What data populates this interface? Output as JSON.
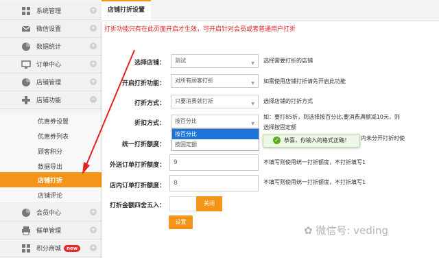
{
  "sidebar": {
    "items": [
      {
        "label": "系统管理",
        "icon": "grid-icon"
      },
      {
        "label": "微信设置",
        "icon": "envelope-icon"
      },
      {
        "label": "数据统计",
        "icon": "pie-chart-icon"
      },
      {
        "label": "订单中心",
        "icon": "monitor-icon"
      },
      {
        "label": "店铺管理",
        "icon": "pie-chart-icon"
      },
      {
        "label": "店铺功能",
        "icon": "cross-icon"
      }
    ],
    "sub_items": [
      {
        "label": "优惠券设置"
      },
      {
        "label": "优惠券列表"
      },
      {
        "label": "顾客积分"
      },
      {
        "label": "数据导出"
      },
      {
        "label": "店铺打折",
        "active": true
      },
      {
        "label": "店铺评论"
      }
    ],
    "bottom_items": [
      {
        "label": "会员中心",
        "icon": "pie-chart-icon"
      },
      {
        "label": "催单管理",
        "icon": "printer-icon"
      },
      {
        "label": "积分商城",
        "icon": "grid-icon",
        "badge": "new"
      }
    ]
  },
  "tab": {
    "label": "店铺打折设置"
  },
  "notice": "打折功能只有在此页面开启才生效，可开启针对会员或者普通用户打折",
  "form": {
    "store_label": "选择店铺：",
    "store_value": "测试",
    "store_hint": "选择需要打折的店铺",
    "enable_label": "开启打折功能：",
    "enable_value": "对所有顾客打折",
    "enable_hint": "如需使用店铺打折请先开启此功能",
    "mode_label": "打折方式：",
    "mode_value": "只要消费就打折",
    "mode_hint": "选择店铺的打折方式",
    "type_label": "折扣方式：",
    "type_value": "按百分比",
    "type_hint_1": "如：要打85折，则选择按百分比,要消费满额减10元，则",
    "type_hint_2": "选择按固定额",
    "type_options": [
      "按百分比",
      "按固定额"
    ],
    "unified_label": "统一打折额度：",
    "unified_hint_tail": "内未分开打折时使",
    "delivery_label": "外送订单打折额度：",
    "delivery_value": "9",
    "delivery_hint": "不填写则使用统一打折额度，不打折填写1",
    "dinein_label": "店内订单打折额度：",
    "dinein_value": "8",
    "dinein_hint": "不填写则使用统一打折额度，不打折填写1",
    "rounding_label": "打折金额四舍五入：",
    "rounding_toggle": "关闭",
    "settings_button": "设置"
  },
  "toast": {
    "text": "恭喜，你输入的格式正确！"
  },
  "watermark": "微信号: veding",
  "colors": {
    "accent": "#f49418",
    "notice": "#e02020",
    "annotation_arrow": "#e32222",
    "selected_option": "#1e73d6"
  }
}
